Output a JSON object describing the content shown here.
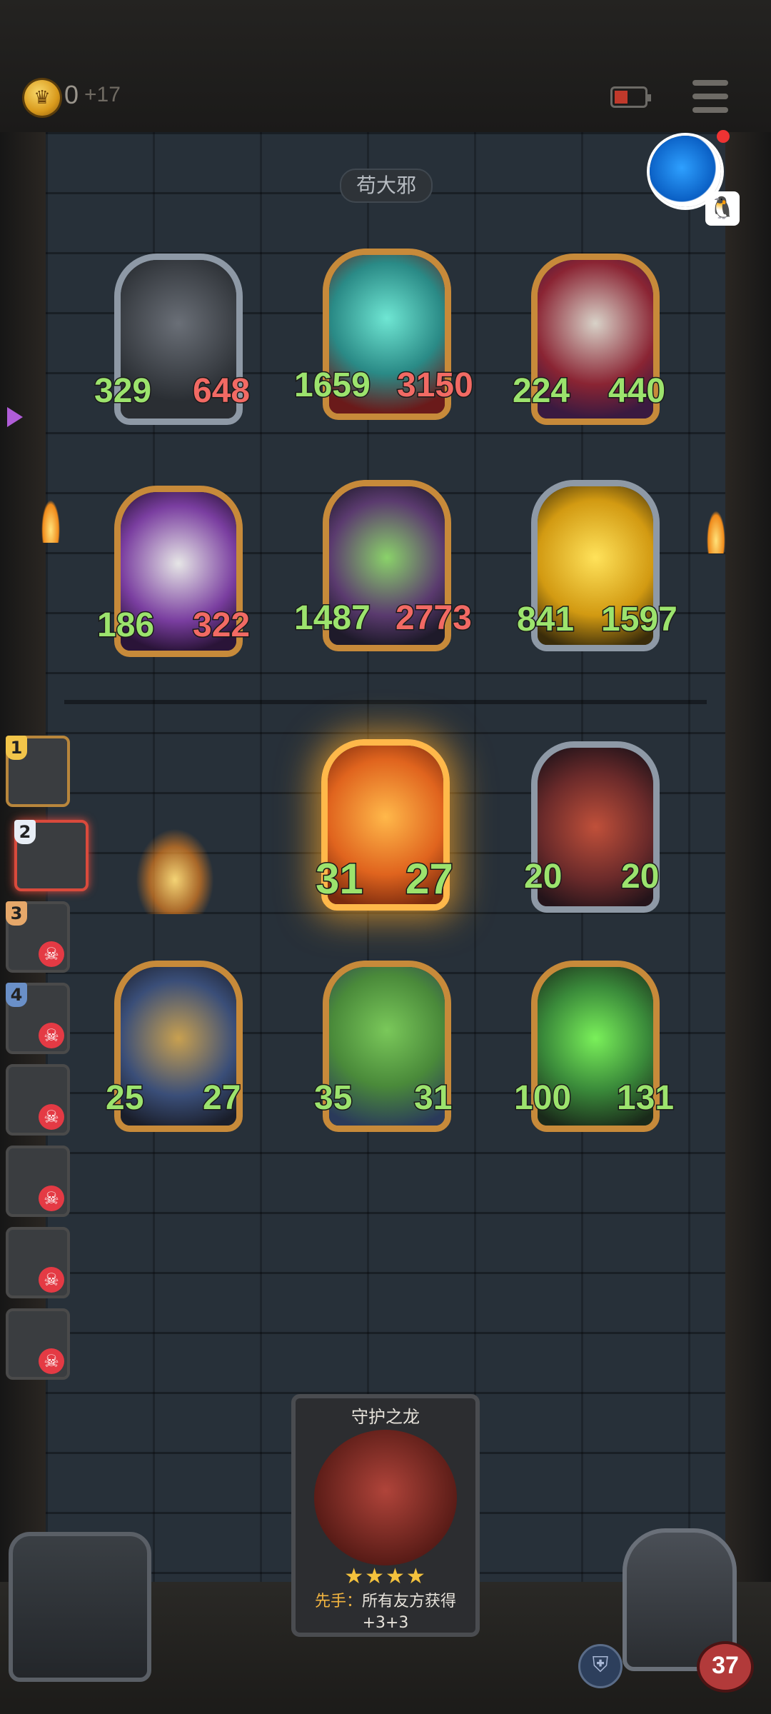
{
  "top_bar": {
    "coin_icon": "crown-coin-icon",
    "coin_value": "0",
    "coin_bonus": "+17",
    "battery_icon": "battery-charging-icon",
    "menu_icon": "hamburger-menu-icon"
  },
  "opponent": {
    "name": "苟大邪"
  },
  "enemy_cards": [
    {
      "atk": "329",
      "hp": "648",
      "frame": "silver"
    },
    {
      "atk": "1659",
      "hp": "3150",
      "frame": "gold"
    },
    {
      "atk": "224",
      "hp": "440",
      "frame": "gold"
    },
    {
      "atk": "186",
      "hp": "322",
      "frame": "gold"
    },
    {
      "atk": "1487",
      "hp": "2773",
      "frame": "gold"
    },
    {
      "atk": "841",
      "hp": "1597",
      "frame": "silver"
    }
  ],
  "player_cards": [
    {
      "atk": "31",
      "hp": "27"
    },
    {
      "atk": "20",
      "hp": "20"
    },
    {
      "atk": "25",
      "hp": "27"
    },
    {
      "atk": "35",
      "hp": "31"
    },
    {
      "atk": "100",
      "hp": "131"
    }
  ],
  "queue": [
    {
      "num": "1"
    },
    {
      "num": "2"
    },
    {
      "num": "3"
    },
    {
      "num": "4"
    }
  ],
  "hand_card": {
    "title": "守护之龙",
    "stars": "★★★★",
    "keyword": "先手：",
    "desc": "所有友方获得",
    "desc2": "+3+3"
  },
  "hero": {
    "hp": "37"
  },
  "colors": {
    "atk": "#9ce36d",
    "hp": "#f26a64",
    "gold_frame": "#c78a3a",
    "silver_frame": "#8e99a6"
  }
}
